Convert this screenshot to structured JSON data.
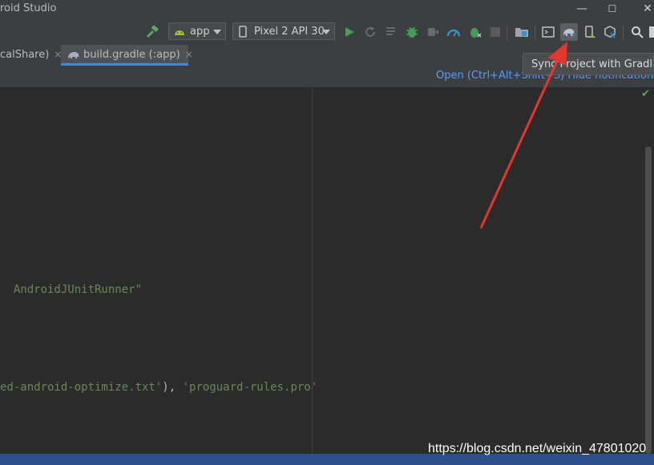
{
  "window": {
    "title": "roid Studio",
    "controls": [
      "—",
      "☐",
      "✕"
    ]
  },
  "toolbar": {
    "config_select": "app",
    "device_select": "Pixel 2 API 30",
    "icons": [
      "build-hammer",
      "run",
      "apply-changes",
      "run-tests",
      "debug",
      "attach-debugger",
      "profile",
      "coverage",
      "stop",
      "project-structure",
      "terminal",
      "sync-gradle",
      "avd-manager",
      "sdk-manager",
      "search"
    ]
  },
  "tabs": [
    {
      "label": "calShare)",
      "close": "×"
    },
    {
      "label": "build.gradle (:app)",
      "close": "×",
      "active": true
    }
  ],
  "notification": {
    "link": "Open (Ctrl+Alt+Shift+S)    Hide notification"
  },
  "tooltip": {
    "text": "Sync Project with Gradle Fi"
  },
  "editor": {
    "lines": [
      {
        "code": "AndroidJUnitRunner\""
      },
      {
        "code": "ed-android-optimize.txt'",
        "plain": "), ",
        "code2": "'proguard-rules.pro'"
      }
    ]
  },
  "watermark": "https://blog.csdn.net/weixin_47801020",
  "colors": {
    "accent": "#4a88c7",
    "annotation_arrow": "#e8352c",
    "string": "#6a8759"
  }
}
